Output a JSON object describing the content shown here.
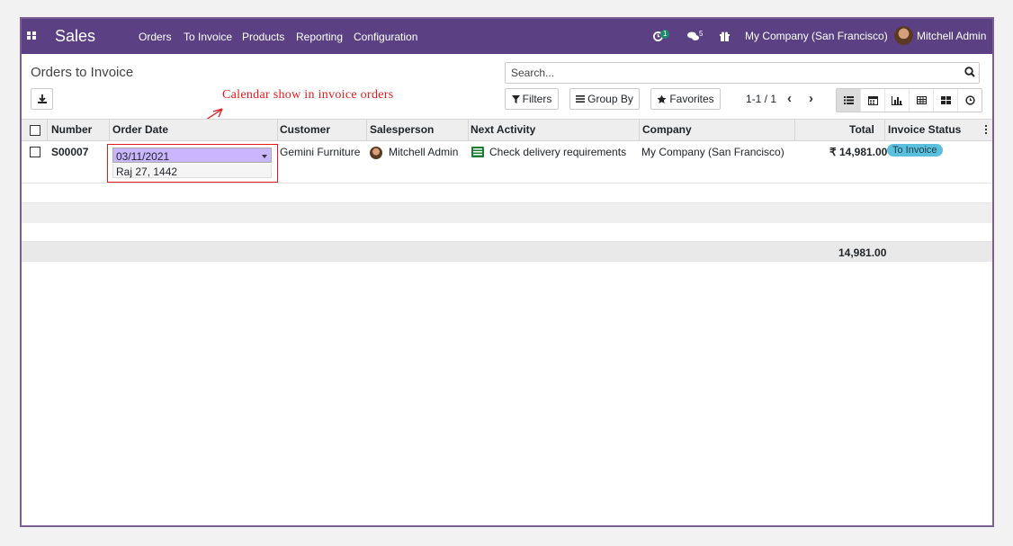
{
  "app": {
    "name": "Sales",
    "menu": [
      "Orders",
      "To Invoice",
      "Products",
      "Reporting",
      "Configuration"
    ],
    "activity_count": "1",
    "messages_count": "5",
    "company": "My Company (San Francisco)",
    "user": "Mitchell Admin"
  },
  "page": {
    "title": "Orders to Invoice",
    "search_placeholder": "Search...",
    "filters_label": "Filters",
    "groupby_label": "Group By",
    "favorites_label": "Favorites",
    "pager": "1-1 / 1",
    "views": [
      "list-icon",
      "calendar-icon",
      "graph-icon",
      "pivot-icon",
      "kanban-icon",
      "activity-icon"
    ]
  },
  "annotation": "Calendar show in invoice orders",
  "annotation_color": "#e51a1a",
  "table": {
    "headers": {
      "number": "Number",
      "order_date": "Order Date",
      "customer": "Customer",
      "salesperson": "Salesperson",
      "next_activity": "Next Activity",
      "company": "Company",
      "total": "Total",
      "invoice_status": "Invoice Status"
    },
    "rows": [
      {
        "number": "S00007",
        "order_date": "03/11/2021",
        "order_date_alt": "Raj 27, 1442",
        "customer": "Gemini Furniture",
        "salesperson": "Mitchell Admin",
        "next_activity": "Check delivery requirements",
        "company": "My Company (San Francisco)",
        "total": "₹ 14,981.00",
        "invoice_status": "To Invoice"
      }
    ],
    "footer_total": "14,981.00"
  },
  "colors": {
    "navbar": "#5b4183",
    "status_badge": "#5bc0de",
    "date_highlight": "#c9b6ff"
  }
}
